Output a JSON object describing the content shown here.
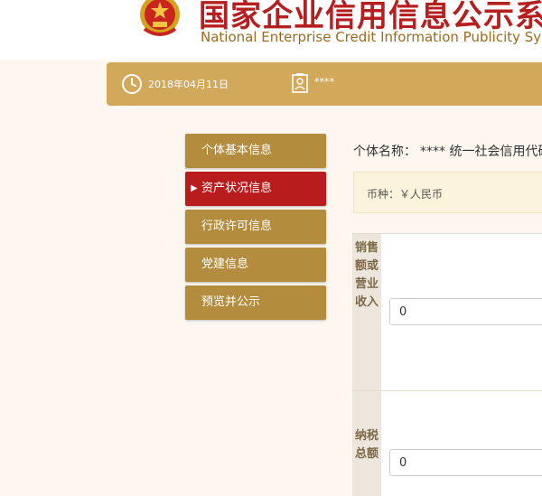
{
  "header": {
    "title_cn": "国家企业信用信息公示系统",
    "title_en": "National Enterprise Credit Information Publicity System"
  },
  "infobar": {
    "date": "2018年04月11日",
    "user": "****"
  },
  "menu": {
    "items": [
      {
        "label": "个体基本信息"
      },
      {
        "label": "资产状况信息"
      },
      {
        "label": "行政许可信息"
      },
      {
        "label": "党建信息"
      },
      {
        "label": "预览并公示"
      }
    ]
  },
  "content": {
    "entity_label": "个体名称：",
    "entity_value": "****",
    "credit_code_label": "统一社会信用代码：",
    "currency": "币种：￥人民币",
    "fields": [
      {
        "label": "销售额或营业收入",
        "value": "0"
      },
      {
        "label": "纳税总额",
        "value": "0"
      }
    ]
  },
  "colors": {
    "gold": "#d2a85a",
    "menu_gold": "#b38d3d",
    "menu_active": "#b81c1c",
    "title_red": "#b51f1f"
  }
}
